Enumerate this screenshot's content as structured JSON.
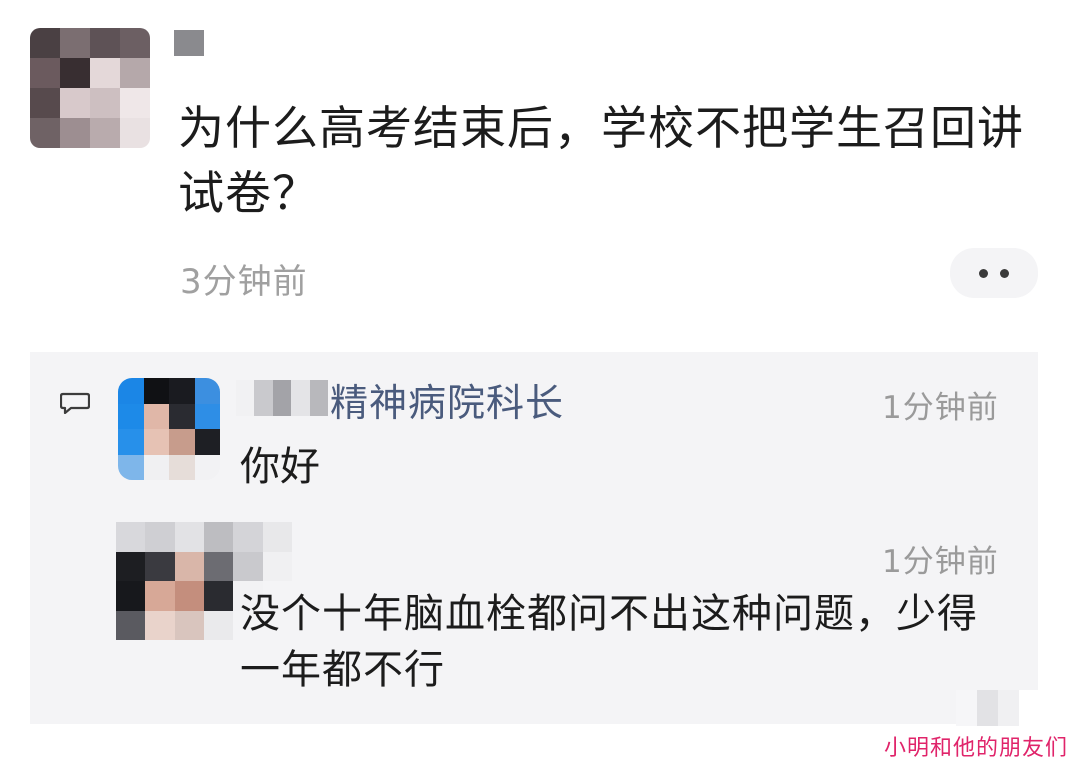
{
  "post": {
    "title": "为什么高考结束后，学校不把学生召回讲试卷？",
    "time": "3分钟前"
  },
  "comments": [
    {
      "author": "精神病院科长",
      "time": "1分钟前",
      "text": "你好"
    },
    {
      "time": "1分钟前",
      "text": "没个十年脑血栓都问不出这种问题，少得一年都不行"
    }
  ],
  "watermark": "小明和他的朋友们",
  "icons": {
    "more": "more-dots-icon",
    "comment": "comment-bubble-icon"
  },
  "colors": {
    "author_name": "#4a5b7d",
    "timestamp": "#9a9a9a",
    "panel_bg": "#f4f4f6",
    "watermark": "#e0246a"
  }
}
